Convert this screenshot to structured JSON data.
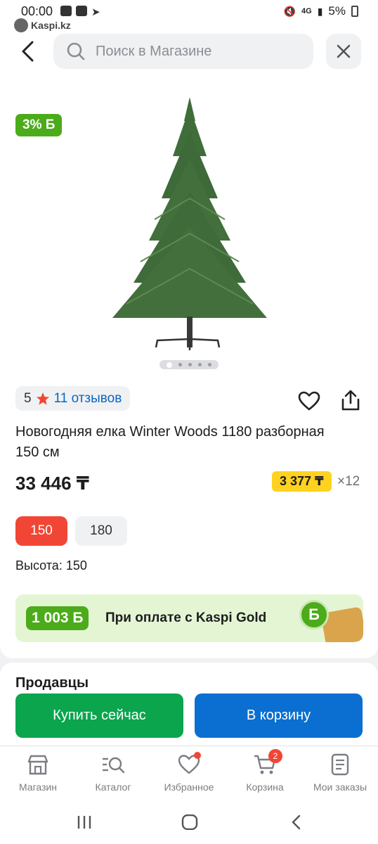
{
  "status_bar": {
    "time": "00:00",
    "battery": "5%",
    "network": "4G"
  },
  "back_app": "Kaspi.kz",
  "header": {
    "search_placeholder": "Поиск в Магазине"
  },
  "product": {
    "bonus_badge": "3% Б",
    "rating": "5",
    "reviews": "11 отзывов",
    "title": "Новогодняя елка Winter Woods 1180 разборная 150 см",
    "price": "33 446 ₸",
    "credit_payment": "3 377 ₸",
    "credit_months": "×12",
    "options": [
      "150",
      "180"
    ],
    "selected_option": "150",
    "height_label": "Высота: 150",
    "image_count": 5,
    "active_image": 1
  },
  "kaspi_gold": {
    "amount": "1 003 Б",
    "text": "При оплате с Kaspi Gold",
    "icon_letter": "Б"
  },
  "sellers_heading": "Продавцы",
  "actions": {
    "buy_now": "Купить сейчас",
    "add_to_cart": "В корзину"
  },
  "bottom_nav": [
    {
      "label": "Магазин",
      "icon": "shop-icon"
    },
    {
      "label": "Каталог",
      "icon": "catalog-search-icon"
    },
    {
      "label": "Избранное",
      "icon": "heart-icon"
    },
    {
      "label": "Корзина",
      "icon": "cart-icon",
      "badge": "2"
    },
    {
      "label": "Мои заказы",
      "icon": "orders-icon"
    }
  ],
  "colors": {
    "green": "#4cab1a",
    "red": "#f14635",
    "blue": "#0a6fd0",
    "buy_green": "#0aa54d",
    "yellow": "#ffd21f"
  }
}
